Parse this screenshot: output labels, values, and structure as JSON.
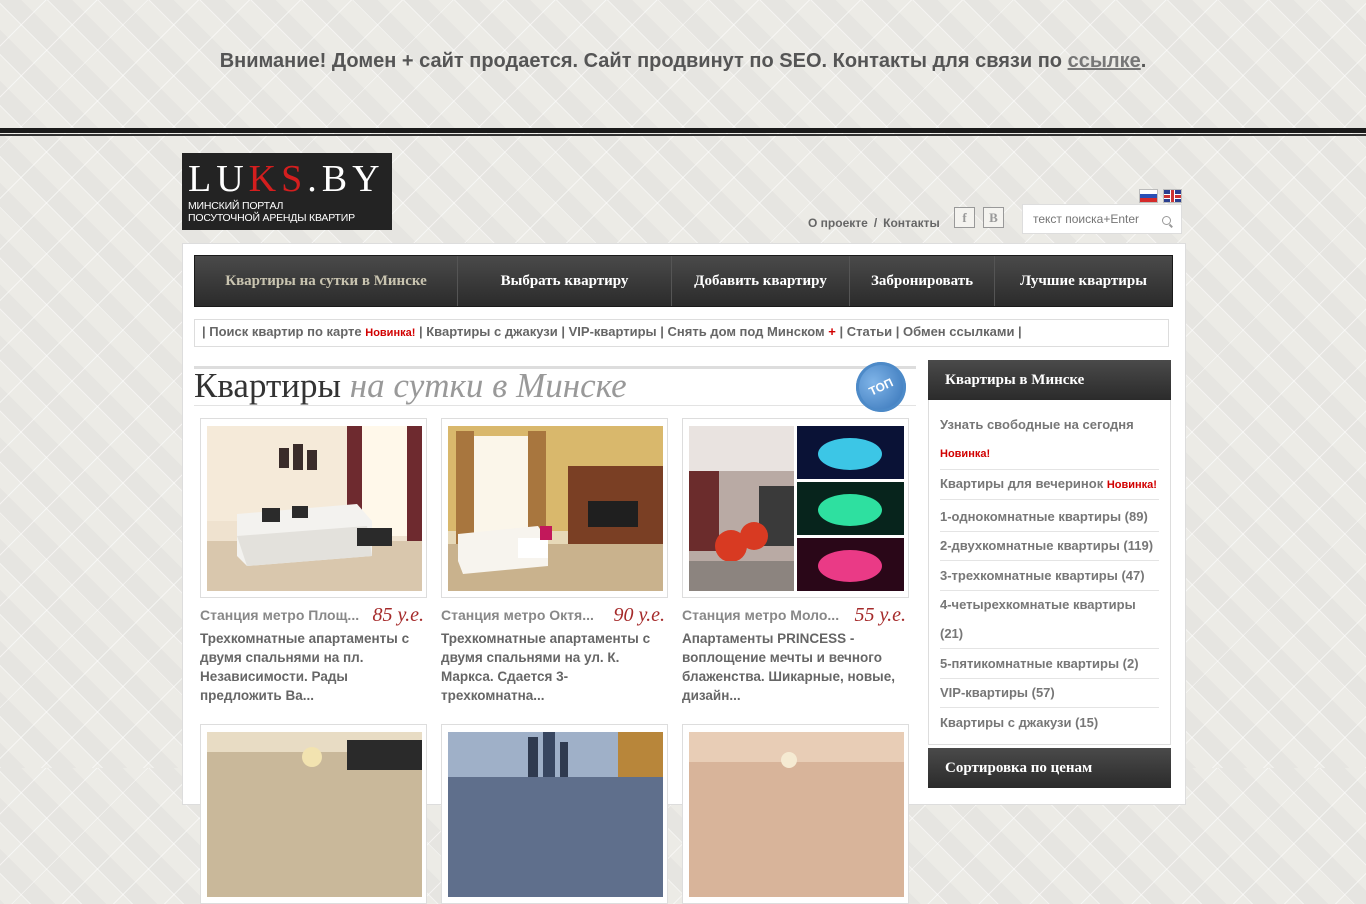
{
  "notice": {
    "text": "Внимание! Домен + сайт продается. Сайт продвинут по SEO. Контакты для связи по ",
    "link": "ссылке",
    "end": "."
  },
  "logo": {
    "part1": "LU",
    "part2": "KS",
    "part3": ".BY",
    "line1": "МИНСКИЙ ПОРТАЛ",
    "line2": "ПОСУТОЧНОЙ АРЕНДЫ КВАРТИР"
  },
  "header": {
    "about": "О проекте",
    "sep": "/",
    "contacts": "Контакты",
    "fb": "f",
    "vk": "B",
    "search_placeholder": "текст поиска+Enter"
  },
  "nav": [
    "Квартиры на сутки в Минске",
    "Выбрать квартиру",
    "Добавить квартиру",
    "Забронировать",
    "Лучшие квартиры"
  ],
  "subnav": {
    "map": "Поиск квартир по карте",
    "new": "Новинка!",
    "jacuzzi": "Квартиры с джакузи",
    "vip": "VIP-квартиры",
    "house": "Снять дом под Минском",
    "plus": "+",
    "articles": "Статьи",
    "exchange": "Обмен ссылками"
  },
  "heading": {
    "main": "Квартиры",
    "italic": "на сутки в Минске",
    "badge": "ТОП"
  },
  "cards": [
    {
      "station": "Станция метро Площ...",
      "price": "85 у.е.",
      "desc": "Трехкомнатные апартаменты с двумя спальнями на пл. Независимости. Рады предложить Ва..."
    },
    {
      "station": "Станция метро Октя...",
      "price": "90 у.е.",
      "desc": "Трехкомнатные апартаменты с двумя спальнями на ул. К. Маркса. Сдается 3-трехкомнатна..."
    },
    {
      "station": "Станция метро Моло...",
      "price": "55 у.е.",
      "desc": "Апартаменты PRINCESS - воплощение мечты и вечного блаженства. Шикарные, новые, дизайн..."
    }
  ],
  "sidebar": {
    "title": "Квартиры в Минске",
    "free_today": "Узнать свободные на сегодня",
    "new1": "Новинка!",
    "party": "Квартиры для вечеринок",
    "new2": "Новинка!",
    "items": [
      "1-однокомнатные квартиры (89)",
      "2-двухкомнатные квартиры (119)",
      "3-трехкомнатные квартиры (47)",
      "4-четырехкомнатые квартиры",
      "(21)",
      "5-пятикомнатные квартиры (2)",
      "VIP-квартиры (57)",
      "Квартиры с джакузи (15)"
    ],
    "title2": "Сортировка по ценам"
  }
}
